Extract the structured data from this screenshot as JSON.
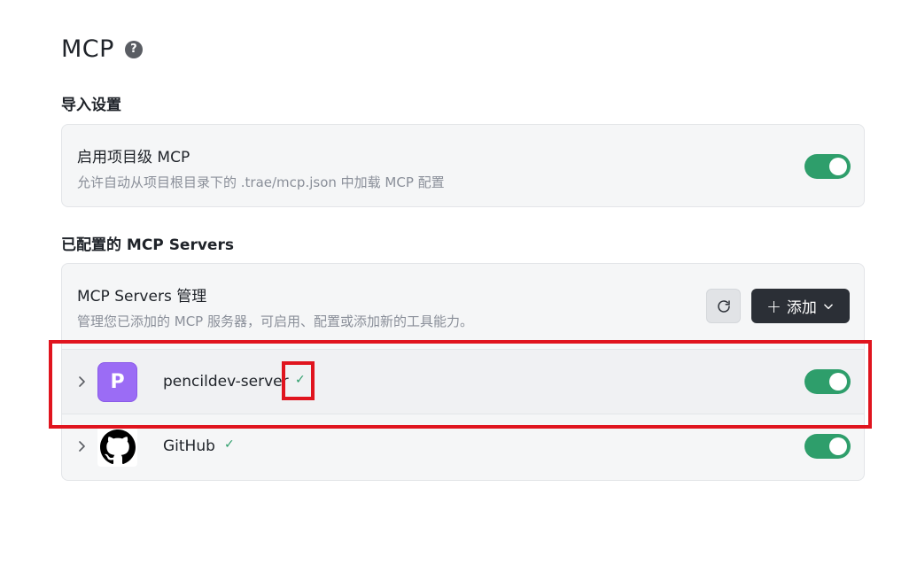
{
  "header": {
    "title": "MCP",
    "help_icon": "help-circle-icon",
    "help_glyph": "?"
  },
  "import_section": {
    "heading": "导入设置",
    "setting_title": "启用项目级 MCP",
    "setting_desc": "允许自动从项目根目录下的 .trae/mcp.json 中加载 MCP 配置",
    "enabled": true
  },
  "servers_section": {
    "heading": "已配置的 MCP Servers",
    "card_title": "MCP Servers 管理",
    "card_desc": "管理您已添加的 MCP 服务器，可启用、配置或添加新的工具能力。",
    "refresh_icon": "refresh-icon",
    "add_label": "添加",
    "add_plus": "+",
    "servers": [
      {
        "name": "pencildev-server",
        "avatar_letter": "P",
        "avatar_color": "#9b6cf5",
        "status_icon": "check-icon",
        "check": "✓",
        "enabled": true
      },
      {
        "name": "GitHub",
        "avatar_icon": "github-icon",
        "status_icon": "check-icon",
        "check": "✓",
        "enabled": true
      }
    ]
  },
  "colors": {
    "accent_green": "#2e9e6b",
    "highlight_red": "#e0141e",
    "button_dark": "#2b2f36"
  }
}
